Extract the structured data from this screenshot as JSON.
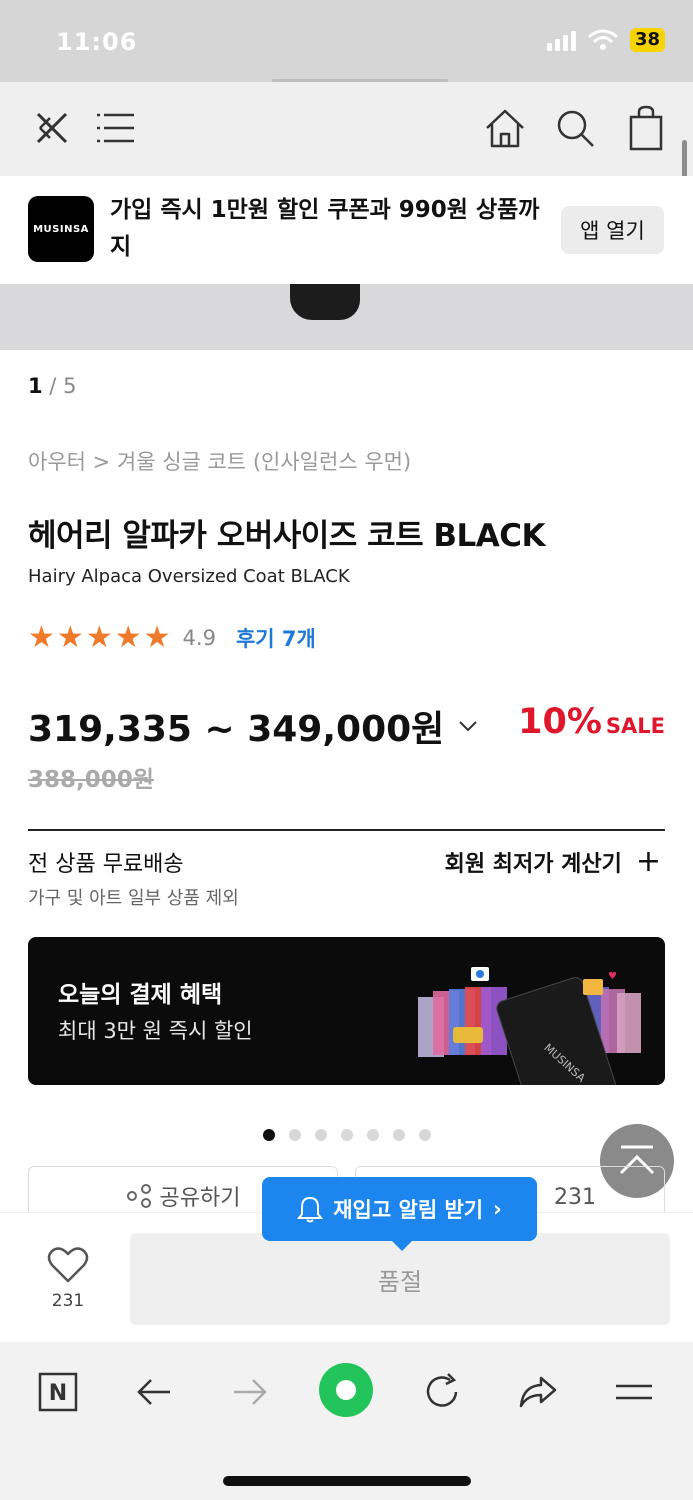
{
  "status_bar": {
    "time": "11:06",
    "battery": "38"
  },
  "nav": {
    "back_icon": "close-x-icon",
    "menu_icon": "hamburger-icon",
    "home_icon": "home-icon",
    "search_icon": "search-icon",
    "cart_icon": "shopping-bag-icon"
  },
  "app_banner": {
    "logo_text": "MUSINSA",
    "message": "가입 즉시 1만원 할인 쿠폰과 990원 상품까지",
    "open_app_label": "앱 열기"
  },
  "gallery": {
    "current": "1",
    "separator": " / ",
    "total": "5"
  },
  "product": {
    "breadcrumb": "아우터 > 겨울 싱글 코트 (인사일런스 우먼)",
    "name_ko": "헤어리 알파카 오버사이즈 코트 BLACK",
    "name_en": "Hairy Alpaca Oversized Coat BLACK",
    "rating": {
      "stars": 5,
      "value": "4.9",
      "reviews_label": "후기 7개"
    },
    "price_range": "319,335 ~ 349,000원",
    "discount_pct": "10%",
    "discount_sale": "SALE",
    "original_price": "388,000원"
  },
  "shipping": {
    "label": "전 상품 무료배송",
    "sub": "가구 및 아트 일부 상품 제외",
    "calc_label": "회원 최저가 계산기"
  },
  "benefit_banner": {
    "title": "오늘의 결제 혜택",
    "subtitle": "최대 3만 원 즉시 할인",
    "card_brand": "MUSINSA",
    "slides": 7,
    "active_slide": 0
  },
  "actions": {
    "share_label": "공유하기",
    "like_count": "231"
  },
  "restock": {
    "label": "재입고 알림 받기",
    "chevron": "›"
  },
  "bottom_bar": {
    "wish_count": "231",
    "soldout_label": "품절"
  },
  "browser": {
    "naver_label": "N"
  },
  "colors": {
    "sale_red": "#e0172c",
    "link_blue": "#1e7ad6",
    "star_orange": "#f07a2b",
    "restock_blue": "#1d86ee",
    "naver_green": "#23c45c"
  }
}
